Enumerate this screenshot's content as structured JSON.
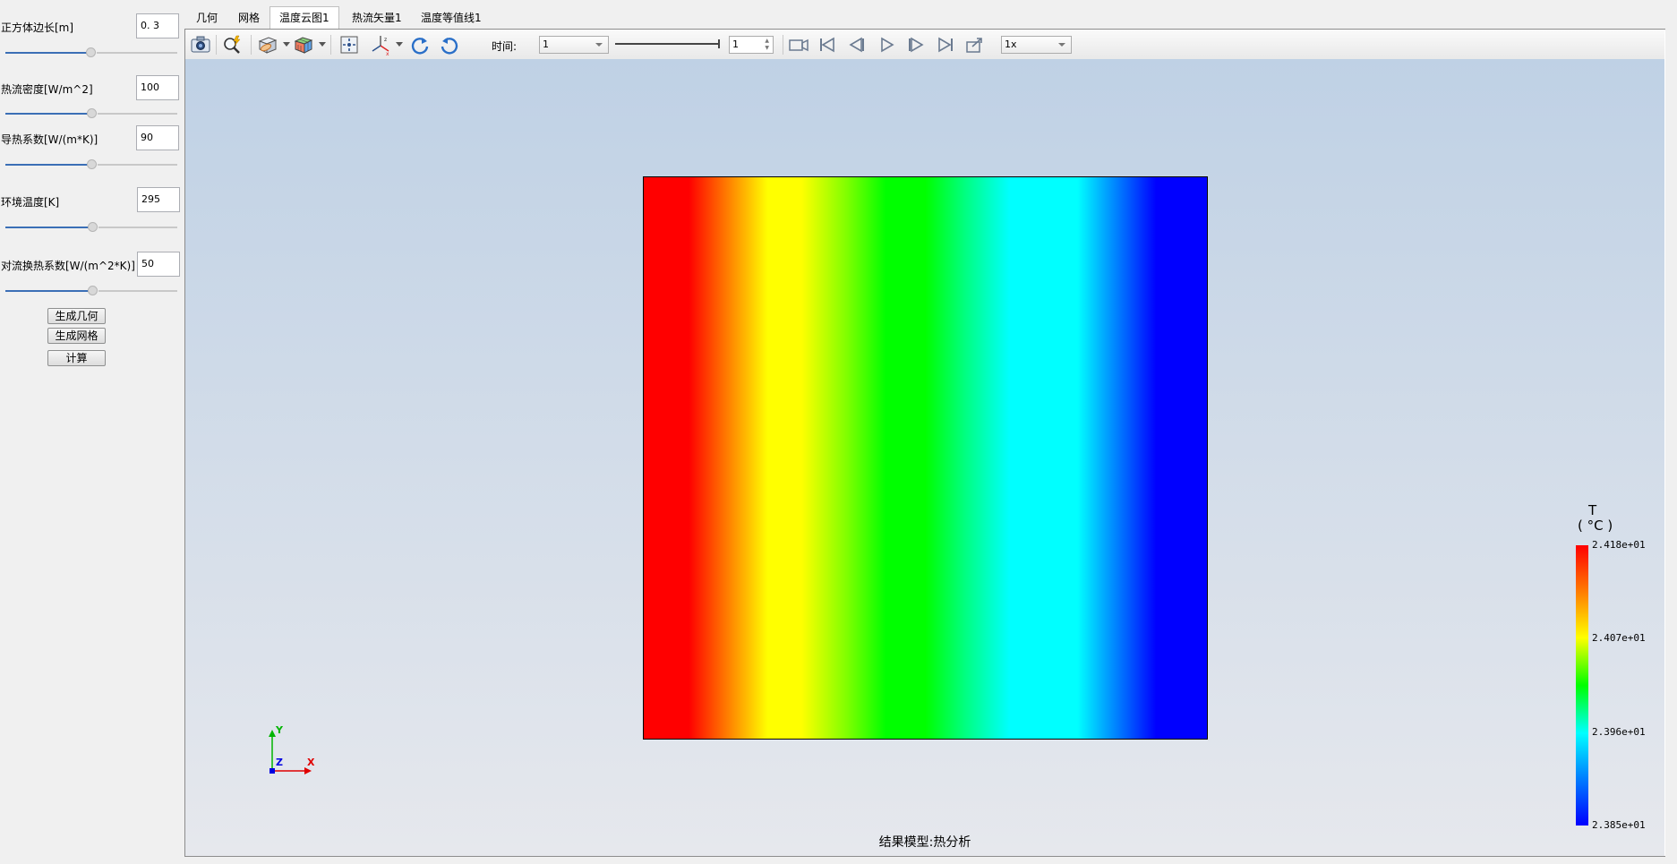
{
  "params": [
    {
      "label": "正方体边长[m]",
      "value": "0. 3",
      "slider": 0.5
    },
    {
      "label": "热流密度[W/m^2]",
      "value": "100",
      "slider": 0.5
    },
    {
      "label": "导热系数[W/(m*K)]",
      "value": "90",
      "slider": 0.5
    },
    {
      "label": "环境温度[K]",
      "value": "295",
      "slider": 0.5
    },
    {
      "label": "对流换热系数[W/(m^2*K)]",
      "value": "50",
      "slider": 0.5
    }
  ],
  "buttons": {
    "gen_geometry": "生成几何",
    "gen_mesh": "生成网格",
    "compute": "计算"
  },
  "tabs": [
    {
      "label": "几何"
    },
    {
      "label": "网格"
    },
    {
      "label": "温度云图1",
      "active": true
    },
    {
      "label": "热流矢量1"
    },
    {
      "label": "温度等值线1"
    }
  ],
  "toolbar": {
    "time_label": "时间:",
    "time_value": "1",
    "frame_value": "1",
    "speed_value": "1x"
  },
  "axes": {
    "y": "Y",
    "z": "Z",
    "x": "X"
  },
  "legend": {
    "title": "T",
    "unit": "( °C )",
    "ticks": [
      "2.418e+01",
      "2.407e+01",
      "2.396e+01",
      "2.385e+01"
    ]
  },
  "caption": "结果模型:热分析",
  "colors": {
    "accent": "#3b6fb6",
    "hot": "#ff0000",
    "cold": "#0000ff"
  }
}
